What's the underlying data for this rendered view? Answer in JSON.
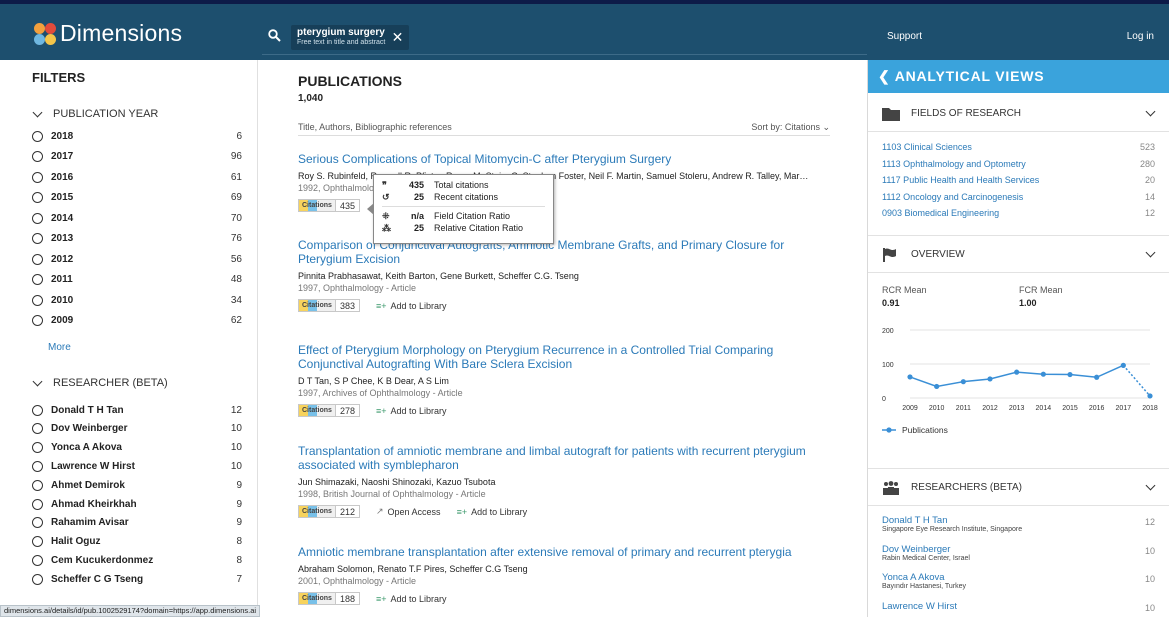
{
  "app": {
    "logo_text": "Dimensions",
    "search_query": "pterygium surgery",
    "search_scope": "Free text in title and abstract",
    "support_label": "Support",
    "login_label": "Log in",
    "status_url": "dimensions.ai/details/id/pub.1002529174?domain=https://app.dimensions.ai"
  },
  "filters": {
    "title": "FILTERS",
    "year_section": "PUBLICATION YEAR",
    "years": [
      {
        "label": "2018",
        "count": "6"
      },
      {
        "label": "2017",
        "count": "96"
      },
      {
        "label": "2016",
        "count": "61"
      },
      {
        "label": "2015",
        "count": "69"
      },
      {
        "label": "2014",
        "count": "70"
      },
      {
        "label": "2013",
        "count": "76"
      },
      {
        "label": "2012",
        "count": "56"
      },
      {
        "label": "2011",
        "count": "48"
      },
      {
        "label": "2010",
        "count": "34"
      },
      {
        "label": "2009",
        "count": "62"
      }
    ],
    "more_label": "More",
    "researcher_section": "RESEARCHER (BETA)",
    "researchers": [
      {
        "label": "Donald T H Tan",
        "count": "12"
      },
      {
        "label": "Dov Weinberger",
        "count": "10"
      },
      {
        "label": "Yonca A Akova",
        "count": "10"
      },
      {
        "label": "Lawrence W Hirst",
        "count": "10"
      },
      {
        "label": "Ahmet Demirok",
        "count": "9"
      },
      {
        "label": "Ahmad Kheirkhah",
        "count": "9"
      },
      {
        "label": "Rahamim Avisar",
        "count": "9"
      },
      {
        "label": "Halit Oguz",
        "count": "8"
      },
      {
        "label": "Cem Kucukerdonmez",
        "count": "8"
      },
      {
        "label": "Scheffer C G Tseng",
        "count": "7"
      }
    ]
  },
  "publications": {
    "title": "PUBLICATIONS",
    "total": "1,040",
    "column_label": "Title, Authors, Bibliographic references",
    "sort_label": "Sort by: Citations",
    "citations_label": "Citations",
    "open_access_label": "Open Access",
    "add_library_label": "Add to Library",
    "items": [
      {
        "title": "Serious Complications of Topical Mitomycin-C after Pterygium Surgery",
        "authors": "Roy S. Rubinfeld, Roswell R. Pfister, Roger M. Stein, C. Stephen Foster, Neil F. Martin, Samuel Stoleru, Andrew R. Talley, Mar…",
        "meta": "1992, Ophthalmology - Article",
        "citations": "435"
      },
      {
        "title": "Comparison of Conjunctival Autografts, Amniotic Membrane Grafts, and Primary Closure for Pterygium Excision",
        "authors": "Pinnita Prabhasawat, Keith Barton, Gene Burkett, Scheffer C.G. Tseng",
        "meta": "1997, Ophthalmology - Article",
        "citations": "383"
      },
      {
        "title": "Effect of Pterygium Morphology on Pterygium Recurrence in a Controlled Trial Comparing Conjunctival Autografting With Bare Sclera Excision",
        "authors": "D T Tan, S P Chee, K B Dear, A S Lim",
        "meta": "1997, Archives of Ophthalmology - Article",
        "citations": "278"
      },
      {
        "title": "Transplantation of amniotic membrane and limbal autograft for patients with recurrent pterygium associated with symblepharon",
        "authors": "Jun Shimazaki, Naoshi Shinozaki, Kazuo Tsubota",
        "meta": "1998, British Journal of Ophthalmology - Article",
        "citations": "212"
      },
      {
        "title": "Amniotic membrane transplantation after extensive removal of primary and recurrent pterygia",
        "authors": "Abraham Solomon, Renato T.F Pires, Scheffer C.G Tseng",
        "meta": "2001, Ophthalmology - Article",
        "citations": "188"
      }
    ]
  },
  "tooltip": {
    "rows": [
      {
        "icon": "❞",
        "value": "435",
        "label": "Total citations"
      },
      {
        "icon": "↺",
        "value": "25",
        "label": "Recent citations"
      },
      {
        "icon": "⁜",
        "value": "n/a",
        "label": "Field Citation Ratio"
      },
      {
        "icon": "⁂",
        "value": "25",
        "label": "Relative Citation Ratio"
      }
    ]
  },
  "views": {
    "title": "ANALYTICAL VIEWS",
    "fields_title": "FIELDS OF RESEARCH",
    "fields": [
      {
        "label": "1103 Clinical Sciences",
        "count": "523"
      },
      {
        "label": "1113 Ophthalmology and Optometry",
        "count": "280"
      },
      {
        "label": "1117 Public Health and Health Services",
        "count": "20"
      },
      {
        "label": "1112 Oncology and Carcinogenesis",
        "count": "14"
      },
      {
        "label": "0903 Biomedical Engineering",
        "count": "12"
      }
    ],
    "overview_title": "OVERVIEW",
    "rcr_label": "RCR Mean",
    "rcr_value": "0.91",
    "fcr_label": "FCR Mean",
    "fcr_value": "1.00",
    "researchers_title": "RESEARCHERS (BETA)",
    "researchers": [
      {
        "name": "Donald T H Tan",
        "aff": "Singapore Eye Research Institute, Singapore",
        "count": "12"
      },
      {
        "name": "Dov Weinberger",
        "aff": "Rabin Medical Center, Israel",
        "count": "10"
      },
      {
        "name": "Yonca A Akova",
        "aff": "Bayındır Hastanesi, Turkey",
        "count": "10"
      },
      {
        "name": "Lawrence W Hirst",
        "aff": "",
        "count": "10"
      }
    ]
  },
  "chart_data": {
    "type": "line",
    "x": [
      "2009",
      "2010",
      "2011",
      "2012",
      "2013",
      "2014",
      "2015",
      "2016",
      "2017",
      "2018"
    ],
    "series": [
      {
        "name": "Publications",
        "values": [
          62,
          34,
          48,
          56,
          76,
          70,
          69,
          61,
          96,
          6
        ]
      }
    ],
    "yticks": [
      0,
      100,
      200
    ],
    "ylim": [
      0,
      200
    ],
    "last_segment_dotted": true,
    "color": "#3a8fd6",
    "legend_position": "bottom-left"
  }
}
